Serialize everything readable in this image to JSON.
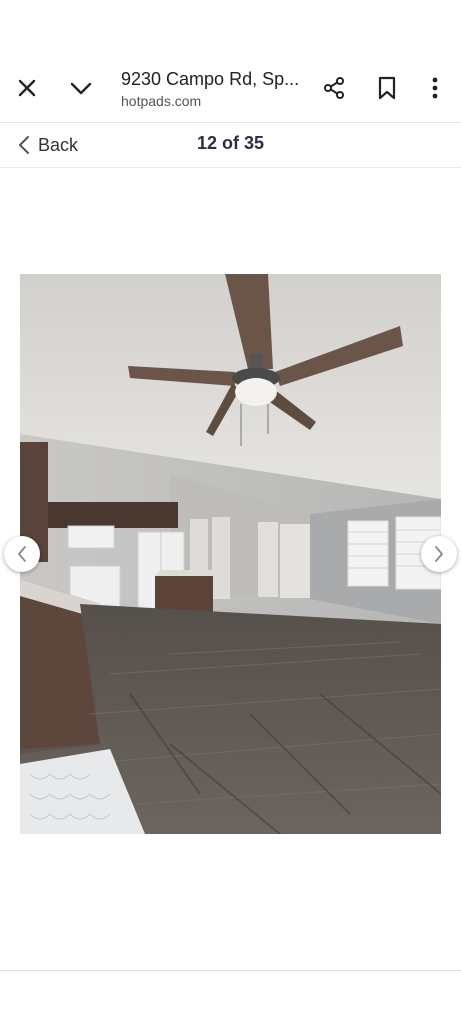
{
  "browser": {
    "title": "9230 Campo Rd, Sp...",
    "url": "hotpads.com",
    "icons": {
      "close": "close-icon",
      "collapse": "chevron-down-icon",
      "share": "share-icon",
      "bookmark": "bookmark-icon",
      "more": "more-vertical-icon"
    }
  },
  "gallery": {
    "back_label": "Back",
    "counter": "12 of 35",
    "photo_alt": "Open living area with kitchen, ceiling fan and wood-look floor",
    "prev_icon": "chevron-left-icon",
    "next_icon": "chevron-right-icon"
  },
  "colors": {
    "counter_text": "#2a2f45",
    "divider": "#e3e3e3"
  }
}
